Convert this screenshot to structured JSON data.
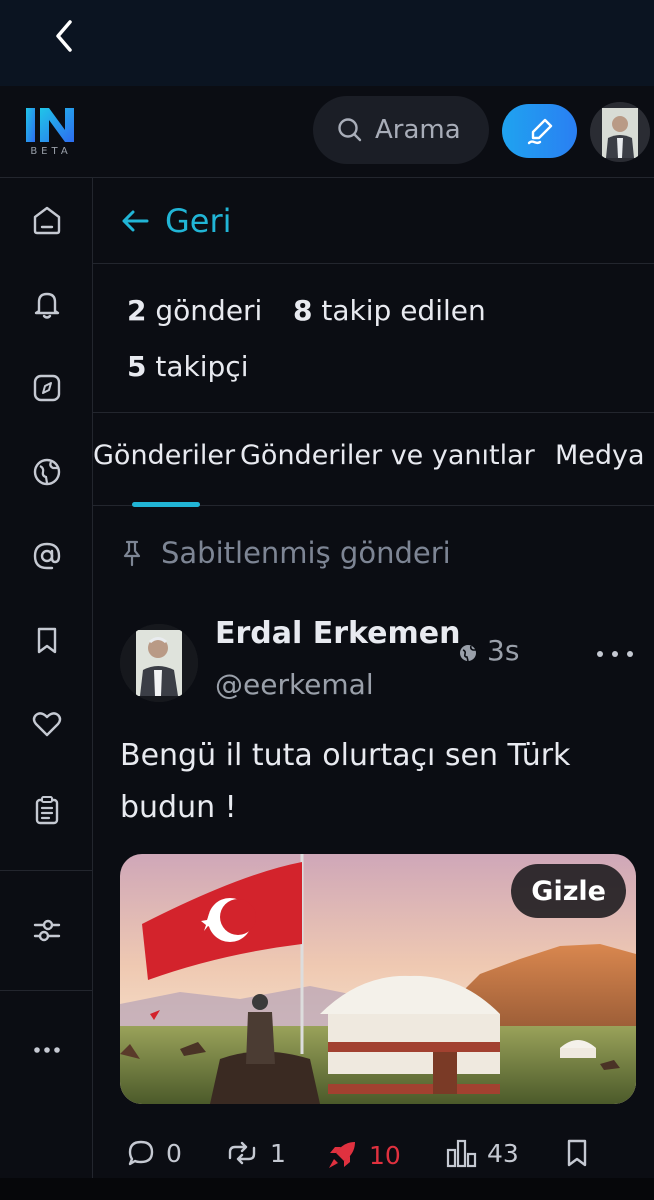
{
  "logo": {
    "beta_label": "BETA"
  },
  "search": {
    "placeholder": "Arama"
  },
  "nav": {
    "back_label": "Geri"
  },
  "profile_stats": {
    "posts": {
      "count": "2",
      "label": "gönderi"
    },
    "following": {
      "count": "8",
      "label": "takip edilen"
    },
    "followers": {
      "count": "5",
      "label": "takipçi"
    }
  },
  "tabs": [
    {
      "label": "Gönderiler",
      "active": true
    },
    {
      "label": "Gönderiler ve yanıtlar",
      "active": false
    },
    {
      "label": "Medya",
      "active": false
    }
  ],
  "pinned_label": "Sabitlenmiş gönderi",
  "post": {
    "author_name": "Erdal Erkemen",
    "author_handle": "@eerkemal",
    "time": "3s",
    "text_line1": "Bengü il tuta olurtaçı sen Türk",
    "text_line2": "budun !",
    "hide_label": "Gizle",
    "replies": "0",
    "boosts": "1",
    "reactions": "10",
    "views": "43"
  },
  "colors": {
    "accent": "#21b5d6",
    "background": "#0b0d13",
    "topbar": "#0b1421",
    "reaction_red": "#e0313f"
  },
  "icons": [
    "chevron-left-icon",
    "search-icon",
    "compose-icon",
    "home-icon",
    "bell-icon",
    "explore-icon",
    "globe-icon",
    "at-icon",
    "bookmark-icon",
    "heart-icon",
    "list-icon",
    "settings-icon",
    "more-icon",
    "pin-icon",
    "globe-small-icon",
    "reply-icon",
    "boost-icon",
    "rocket-icon",
    "stats-icon"
  ]
}
